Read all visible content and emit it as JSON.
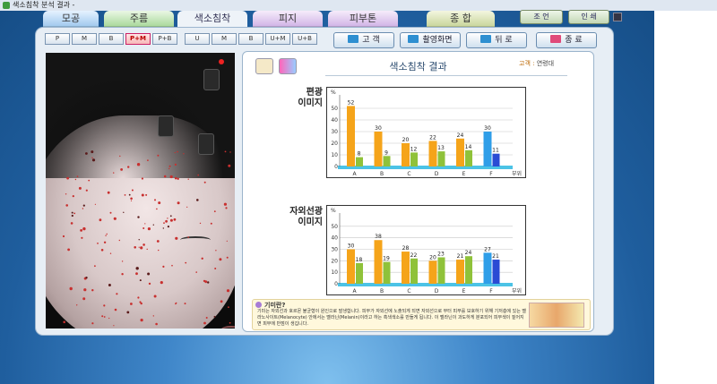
{
  "window": {
    "title": "색소침착 분석 결과 - "
  },
  "tabs": [
    {
      "label": "모공",
      "style": "blue"
    },
    {
      "label": "주름",
      "style": "green"
    },
    {
      "label": "색소침착",
      "style": "active"
    },
    {
      "label": "피지",
      "style": "purple"
    },
    {
      "label": "피부톤",
      "style": "purple"
    },
    {
      "label": "종 합",
      "style": "olive"
    }
  ],
  "topright": {
    "settings": "조 언",
    "print": "인 쇄"
  },
  "small_buttons_left": [
    "P",
    "M",
    "B",
    "P+M",
    "P+B"
  ],
  "small_buttons_right": [
    "U",
    "M",
    "B",
    "U+M",
    "U+B"
  ],
  "active_small": "P+M",
  "nav": {
    "customer": "고 객",
    "capture": "촬영화면",
    "back": "뒤 로",
    "exit": "종 료"
  },
  "result": {
    "title": "색소침착 결과",
    "customer_label": "고객 :",
    "customer_name": "연령대",
    "section1": "편광\n이미지",
    "section2": "자외선광\n이미지"
  },
  "info": {
    "question": "기미란?",
    "text": "기미는 자외선과 호르몬 불균형이 원인으로 발생합니다. 피부가 자외선에 노출되게 되면 자외선으로 부터 피부를 보호하기 위해 기저층에 있는 멜라노사이트(Melanocyte) 안에서는 멜라닌(Melanin)이라고 하는 흑색색소를 만들게 됩니다. 이 멜라닌이 과도하게 분포되어 피부색이 짙어지면 피부에 반점이 생깁니다."
  },
  "colors": {
    "orange": "#f5a41a",
    "green": "#8fc23a",
    "blue": "#2f9ee8",
    "navy": "#2a4bd4",
    "floor": "#4cc3e6"
  },
  "chart_data": [
    {
      "type": "bar",
      "categories": [
        "A",
        "B",
        "C",
        "D",
        "E",
        "F"
      ],
      "xlabel": "부위",
      "ylabel": "%",
      "ylim": [
        0,
        60
      ],
      "yticks": [
        0,
        10,
        20,
        30,
        40,
        50
      ],
      "series": [
        {
          "values": [
            52,
            30,
            20,
            22,
            24,
            30
          ]
        },
        {
          "values": [
            8,
            9,
            12,
            13,
            14,
            11
          ]
        }
      ]
    },
    {
      "type": "bar",
      "categories": [
        "A",
        "B",
        "C",
        "D",
        "E",
        "F"
      ],
      "xlabel": "부위",
      "ylabel": "%",
      "ylim": [
        0,
        60
      ],
      "yticks": [
        0,
        10,
        20,
        30,
        40,
        50
      ],
      "series": [
        {
          "values": [
            30,
            38,
            28,
            20,
            21,
            27
          ]
        },
        {
          "values": [
            18,
            19,
            22,
            23,
            24,
            21
          ]
        }
      ]
    }
  ]
}
